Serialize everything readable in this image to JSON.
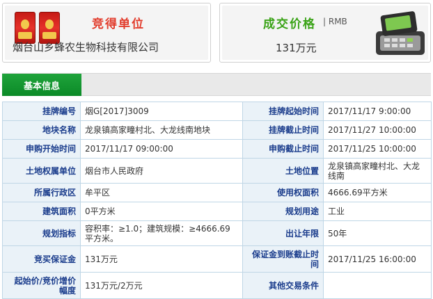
{
  "winner": {
    "title": "竞得单位",
    "company": "烟台山乡蜂农生物科技有限公司"
  },
  "price": {
    "title": "成交价格",
    "unit": "| RMB",
    "value": "131万元"
  },
  "section": {
    "tab_label": "基本信息"
  },
  "rows": [
    {
      "l1": "挂牌编号",
      "v1": "烟G[2017]3009",
      "l2": "挂牌起始时间",
      "v2": "2017/11/17 9:00:00"
    },
    {
      "l1": "地块名称",
      "v1": "龙泉镇高家疃村北、大龙线南地块",
      "l2": "挂牌截止时间",
      "v2": "2017/11/27 10:00:00"
    },
    {
      "l1": "申购开始时间",
      "v1": "2017/11/17 09:00:00",
      "l2": "申购截止时间",
      "v2": "2017/11/25 10:00:00"
    },
    {
      "l1": "土地权属单位",
      "v1": "烟台市人民政府",
      "l2": "土地位置",
      "v2": "龙泉镇高家疃村北、大龙线南"
    },
    {
      "l1": "所属行政区",
      "v1": "牟平区",
      "l2": "使用权面积",
      "v2": "4666.69平方米"
    },
    {
      "l1": "建筑面积",
      "v1": "0平方米",
      "l2": "规划用途",
      "v2": "工业"
    },
    {
      "l1": "规划指标",
      "v1": "容积率：≥1.0；建筑规模：≥4666.69平方米。",
      "l2": "出让年限",
      "v2": "50年"
    },
    {
      "l1": "竞买保证金",
      "v1": "131万元",
      "l2": "保证金到账截止时间",
      "v2": "2017/11/25 16:00:00"
    },
    {
      "l1": "起始价/竞价增价幅度",
      "v1": "131万元/2万元",
      "l2": "其他交易条件",
      "v2": ""
    }
  ],
  "icons": {
    "product_image": "liquor-bottles-image",
    "machine_image": "pos-terminal-icon"
  },
  "colors": {
    "winner_title": "#e23b2b",
    "price_title": "#3aa317",
    "tab": "#0b8a27",
    "label_text": "#1a3c8c",
    "label_bg": "#eaf2f8"
  }
}
